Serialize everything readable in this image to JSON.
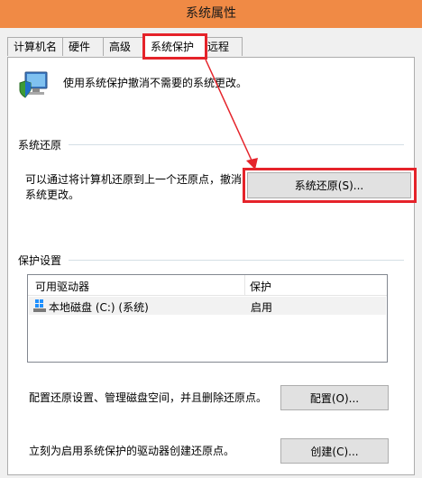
{
  "window": {
    "title": "系统属性"
  },
  "tabs": [
    {
      "label": "计算机名",
      "active": false
    },
    {
      "label": "硬件",
      "active": false
    },
    {
      "label": "高级",
      "active": false
    },
    {
      "label": "系统保护",
      "active": true
    },
    {
      "label": "远程",
      "active": false
    }
  ],
  "intro": {
    "text": "使用系统保护撤消不需要的系统更改。",
    "icon": "computer-shield-icon"
  },
  "restore": {
    "group_title": "系统还原",
    "description_line1": "可以通过将计算机还原到上一个还原点，撤消",
    "description_line2": "系统更改。",
    "button_label": "系统还原(S)..."
  },
  "protection": {
    "group_title": "保护设置",
    "columns": [
      "可用驱动器",
      "保护"
    ],
    "rows": [
      {
        "drive": "本地磁盘 (C:) (系统)",
        "status": "启用",
        "icon": "windows-drive-icon"
      }
    ]
  },
  "configure": {
    "text": "配置还原设置、管理磁盘空间，并且删除还原点。",
    "button_label": "配置(O)..."
  },
  "create": {
    "text": "立刻为启用系统保护的驱动器创建还原点。",
    "button_label": "创建(C)..."
  },
  "colors": {
    "titlebar": "#f08a45",
    "highlight": "#e5232a",
    "window_bg": "#f0f0f0"
  }
}
